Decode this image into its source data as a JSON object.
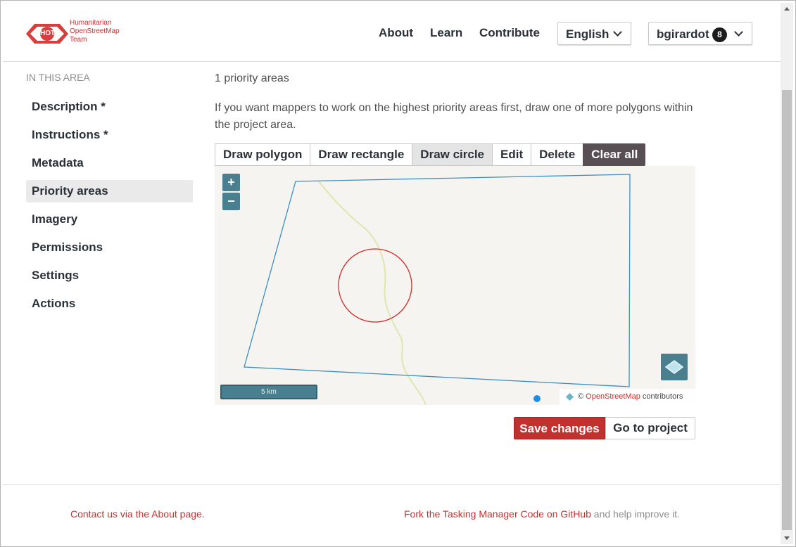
{
  "header": {
    "logo_badge": "HOT",
    "logo_lines": [
      "Humanitarian",
      "OpenStreetMap",
      "Team"
    ],
    "nav": {
      "about": "About",
      "learn": "Learn",
      "contribute": "Contribute"
    },
    "language": "English",
    "user": {
      "name": "bgirardot",
      "notifications": "8"
    }
  },
  "sidebar": {
    "heading": "IN THIS AREA",
    "items": [
      {
        "label": "Description *",
        "active": false
      },
      {
        "label": "Instructions *",
        "active": false
      },
      {
        "label": "Metadata",
        "active": false
      },
      {
        "label": "Priority areas",
        "active": true
      },
      {
        "label": "Imagery",
        "active": false
      },
      {
        "label": "Permissions",
        "active": false
      },
      {
        "label": "Settings",
        "active": false
      },
      {
        "label": "Actions",
        "active": false
      }
    ]
  },
  "main": {
    "count": "1 priority areas",
    "description": "If you want mappers to work on the highest priority areas first, draw one of more polygons within the project area.",
    "toolbar": {
      "draw_polygon": "Draw polygon",
      "draw_rectangle": "Draw rectangle",
      "draw_circle": "Draw circle",
      "edit": "Edit",
      "delete": "Delete",
      "clear_all": "Clear all",
      "active": "Draw circle"
    },
    "map": {
      "zoom_in": "+",
      "zoom_out": "−",
      "scale": "5 km",
      "attribution_prefix": "©",
      "attribution_link": "OpenStreetMap",
      "attribution_suffix": "contributors"
    },
    "actions": {
      "save": "Save changes",
      "go_to_project": "Go to project"
    }
  },
  "footer": {
    "left": "Contact us via the About page.",
    "right_link": "Fork the Tasking Manager Code on GitHub",
    "right_text": " and help improve it."
  },
  "colors": {
    "brand_red": "#c3312f",
    "map_control": "#4a7f90",
    "clear_all": "#584f55",
    "polygon": "#3a8fc4",
    "circle": "#d42a2a"
  },
  "icons": [
    "hot-logo-icon",
    "chevron-down-icon",
    "layers-icon",
    "leaflet-icon"
  ]
}
